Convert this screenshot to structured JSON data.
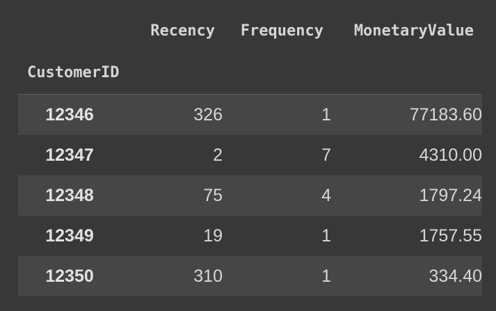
{
  "table": {
    "columns": [
      "Recency",
      "Frequency",
      "MonetaryValue"
    ],
    "index_name": "CustomerID",
    "rows": [
      {
        "index": "12346",
        "recency": "326",
        "frequency": "1",
        "monetary": "77183.60"
      },
      {
        "index": "12347",
        "recency": "2",
        "frequency": "7",
        "monetary": "4310.00"
      },
      {
        "index": "12348",
        "recency": "75",
        "frequency": "4",
        "monetary": "1797.24"
      },
      {
        "index": "12349",
        "recency": "19",
        "frequency": "1",
        "monetary": "1757.55"
      },
      {
        "index": "12350",
        "recency": "310",
        "frequency": "1",
        "monetary": "334.40"
      }
    ]
  },
  "colors": {
    "background": "#383838",
    "striped_row": "#464646",
    "text": "#d5d5d5"
  }
}
